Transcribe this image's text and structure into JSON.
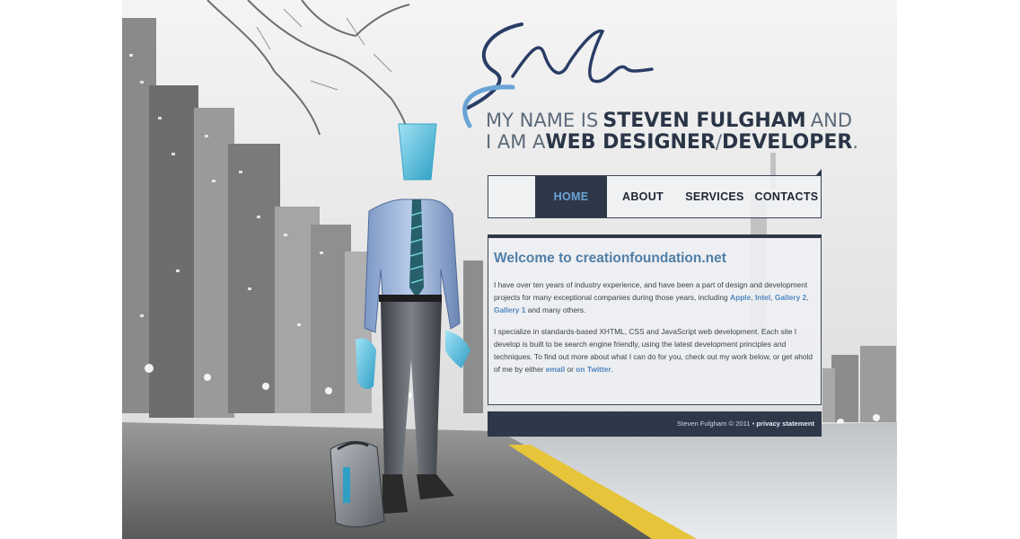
{
  "header": {
    "intro_1": "MY NAME IS",
    "name": "STEVEN FULGHAM",
    "intro_2": "AND",
    "intro_3": "I AM A",
    "role_1": "WEB DESIGNER",
    "slash": "/",
    "role_2": "DEVELOPER",
    "period": ".",
    "signature_icon": "handwritten-signature"
  },
  "nav": {
    "items": [
      {
        "label": "HOME",
        "active": true
      },
      {
        "label": "ABOUT"
      },
      {
        "label": "SERVICES"
      },
      {
        "label": "CONTACTS"
      }
    ]
  },
  "content": {
    "title": "Welcome to creationfoundation.net",
    "p1_text_a": "I have over ten years of industry experience, and have been a part of design and development projects for many exceptional companies during those years, including ",
    "p1_links": [
      "Apple",
      "Intel",
      "Gallery 2",
      "Gallery 1"
    ],
    "p1_sep": ", ",
    "p1_text_b": " and many others.",
    "p2_text_a": "I specialize in standards-based XHTML, CSS and JavaScript web development. Each site I develop is built to be search engine friendly, using the latest development principles and techniques. To find out more about what I can do for you, check out my work below, or get ahold of me by either ",
    "p2_link_email": "email",
    "p2_or": " or ",
    "p2_link_twitter": "on Twitter",
    "p2_end": "."
  },
  "footer": {
    "copyright": "Steven Fulgham © 2011",
    "bullet": "•",
    "privacy": "privacy statement"
  },
  "colors": {
    "accent_blue": "#4f7fa8",
    "nav_dark": "#2e3849",
    "road_stripe": "#e6c53a",
    "figure_cyan": "#5cc3e0"
  }
}
